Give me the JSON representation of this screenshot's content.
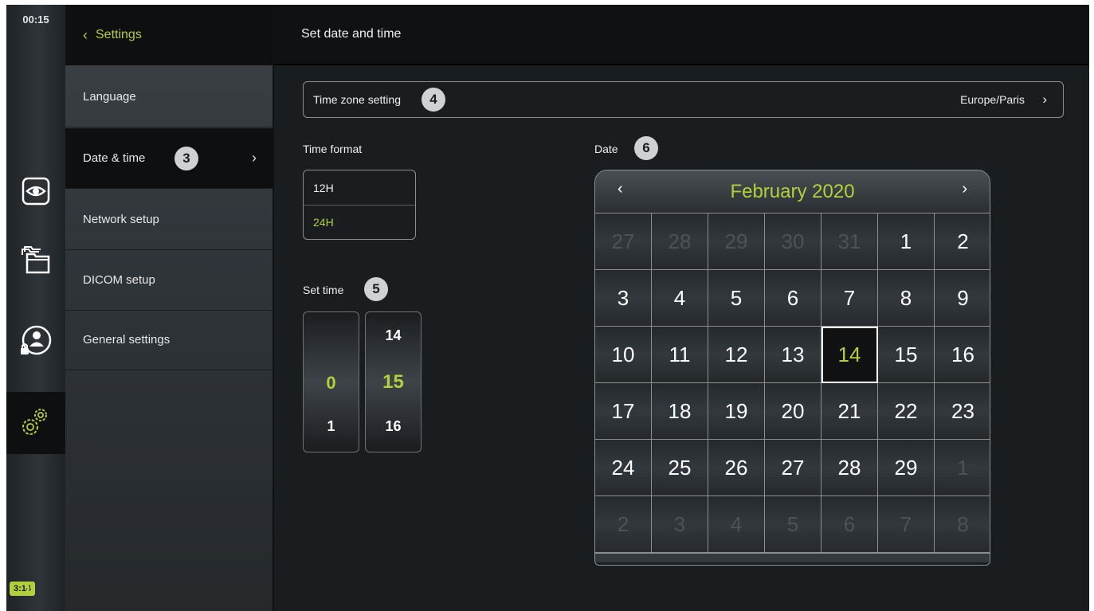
{
  "status": {
    "clock": "00:15",
    "battery": "3:14"
  },
  "rail": [
    {
      "name": "live-view-icon"
    },
    {
      "name": "archive-icon"
    },
    {
      "name": "user-lock-icon"
    },
    {
      "name": "settings-gears-icon"
    }
  ],
  "menu": {
    "header": "Settings",
    "items": [
      {
        "label": "Language"
      },
      {
        "label": "Date & time",
        "badge": "3"
      },
      {
        "label": "Network setup"
      },
      {
        "label": "DICOM setup"
      },
      {
        "label": "General settings"
      }
    ]
  },
  "main": {
    "title": "Set date and time",
    "timezone": {
      "label": "Time zone setting",
      "badge": "4",
      "value": "Europe/Paris"
    },
    "time_format": {
      "label": "Time format",
      "options": [
        "12H",
        "24H"
      ],
      "selected": "24H"
    },
    "set_time": {
      "label": "Set time",
      "badge": "5",
      "hours": {
        "selected": "0",
        "next": "1"
      },
      "minutes": {
        "prev": "14",
        "selected": "15",
        "next": "16"
      }
    },
    "date": {
      "label": "Date",
      "badge": "6",
      "month": "February 2020",
      "selected_day": "14",
      "days": [
        {
          "d": "27",
          "dim": true
        },
        {
          "d": "28",
          "dim": true
        },
        {
          "d": "29",
          "dim": true
        },
        {
          "d": "30",
          "dim": true
        },
        {
          "d": "31",
          "dim": true
        },
        {
          "d": "1"
        },
        {
          "d": "2"
        },
        {
          "d": "3"
        },
        {
          "d": "4"
        },
        {
          "d": "5"
        },
        {
          "d": "6"
        },
        {
          "d": "7"
        },
        {
          "d": "8"
        },
        {
          "d": "9"
        },
        {
          "d": "10"
        },
        {
          "d": "11"
        },
        {
          "d": "12"
        },
        {
          "d": "13"
        },
        {
          "d": "14",
          "sel": true
        },
        {
          "d": "15"
        },
        {
          "d": "16"
        },
        {
          "d": "17"
        },
        {
          "d": "18"
        },
        {
          "d": "19"
        },
        {
          "d": "20"
        },
        {
          "d": "21"
        },
        {
          "d": "22"
        },
        {
          "d": "23"
        },
        {
          "d": "24"
        },
        {
          "d": "25"
        },
        {
          "d": "26"
        },
        {
          "d": "27"
        },
        {
          "d": "28"
        },
        {
          "d": "29"
        },
        {
          "d": "1",
          "dim": true
        },
        {
          "d": "2",
          "dim": true
        },
        {
          "d": "3",
          "dim": true
        },
        {
          "d": "4",
          "dim": true
        },
        {
          "d": "5",
          "dim": true
        },
        {
          "d": "6",
          "dim": true
        },
        {
          "d": "7",
          "dim": true
        },
        {
          "d": "8",
          "dim": true
        }
      ]
    }
  },
  "colors": {
    "accent": "#b4cf3c",
    "background": "#1a1d20",
    "header": "#0f1112"
  }
}
